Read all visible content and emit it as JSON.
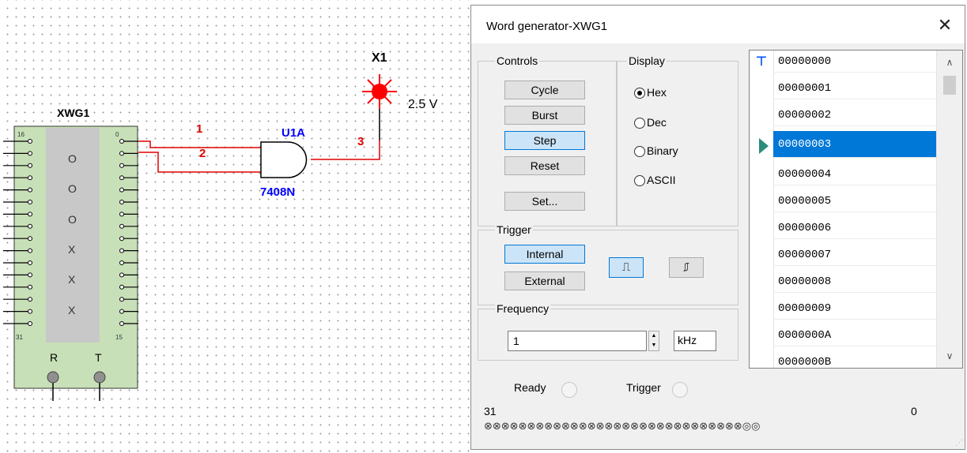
{
  "schematic": {
    "generator_label": "XWG1",
    "pin_top_left": "16",
    "pin_top_right": "0",
    "pin_bottom_left": "31",
    "pin_bottom_right": "15",
    "pin_r": "R",
    "pin_t": "T",
    "status_marks": [
      "O",
      "O",
      "O",
      "X",
      "X",
      "X"
    ],
    "gate_ref": "U1A",
    "gate_part": "7408N",
    "net1": "1",
    "net2": "2",
    "net3": "3",
    "probe_ref": "X1",
    "probe_value": "2.5 V"
  },
  "dialog": {
    "title": "Word generator-XWG1",
    "close_icon": "close-icon",
    "controls": {
      "label": "Controls",
      "buttons": [
        "Cycle",
        "Burst",
        "Step",
        "Reset"
      ],
      "active": "Step",
      "set_button": "Set..."
    },
    "display": {
      "label": "Display",
      "options": [
        "Hex",
        "Dec",
        "Binary",
        "ASCII"
      ],
      "selected": "Hex"
    },
    "trigger": {
      "label": "Trigger",
      "internal": "Internal",
      "external": "External",
      "rising_icon": "rising-edge-icon",
      "falling_icon": "falling-edge-icon"
    },
    "frequency": {
      "label": "Frequency",
      "value": "1",
      "unit": "kHz"
    },
    "status": {
      "ready": "Ready",
      "trigger": "Trigger"
    },
    "bits": {
      "msb": "31",
      "lsb": "0",
      "pattern": "⊗⊗⊗⊗⊗⊗⊗⊗⊗⊗⊗⊗⊗⊗⊗⊗⊗⊗⊗⊗⊗⊗⊗⊗⊗⊗⊗⊗⊗⊗◎◎"
    },
    "words": [
      "00000000",
      "00000001",
      "00000002",
      "00000003",
      "00000004",
      "00000005",
      "00000006",
      "00000007",
      "00000008",
      "00000009",
      "0000000A",
      "0000000B"
    ],
    "selected_word": "00000003",
    "colors": {
      "selection": "#0078d7",
      "wire": "#e00000",
      "gate": "#0000ff",
      "probe": "#ff0000",
      "generator_body": "#c8e0b8",
      "generator_inner": "#c8c8c8"
    }
  }
}
